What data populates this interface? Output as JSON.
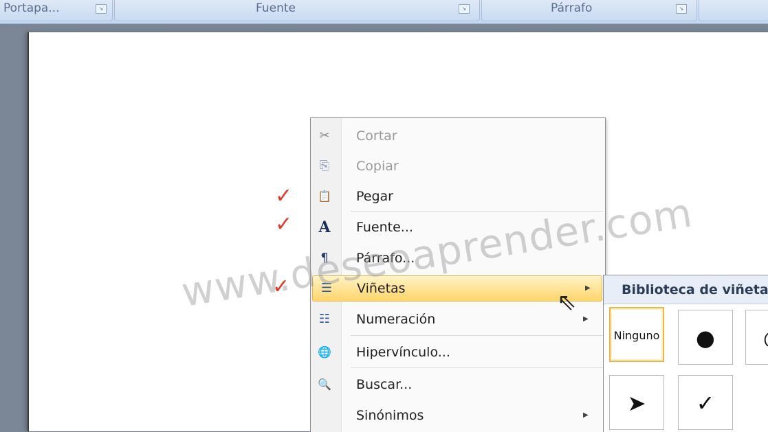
{
  "ribbon": {
    "groups": [
      {
        "label": "Portapa..."
      },
      {
        "label": "Fuente"
      },
      {
        "label": "Párrafo"
      }
    ]
  },
  "annotations": {
    "check": "✓"
  },
  "context_menu": {
    "items": [
      {
        "label": "Cortar",
        "icon": "scissors-icon",
        "glyph": "✂",
        "enabled": false
      },
      {
        "label": "Copiar",
        "icon": "copy-icon",
        "glyph": "⎘",
        "enabled": false
      },
      {
        "label": "Pegar",
        "icon": "paste-icon",
        "glyph": "📋",
        "enabled": true
      },
      {
        "label": "Fuente...",
        "icon": "font-icon",
        "glyph": "A",
        "enabled": true
      },
      {
        "label": "Párrafo...",
        "icon": "paragraph-icon",
        "glyph": "¶",
        "enabled": true
      },
      {
        "label": "Viñetas",
        "icon": "bullets-icon",
        "glyph": "☰",
        "enabled": true,
        "submenu": true,
        "highlighted": true
      },
      {
        "label": "Numeración",
        "icon": "numbering-icon",
        "glyph": "☷",
        "enabled": true,
        "submenu": true
      },
      {
        "label": "Hipervínculo...",
        "icon": "hyperlink-icon",
        "glyph": "🌐",
        "enabled": true
      },
      {
        "label": "Buscar...",
        "icon": "search-icon",
        "glyph": "🔍",
        "enabled": true
      },
      {
        "label": "Sinónimos",
        "icon": "",
        "glyph": "",
        "enabled": true,
        "submenu": true
      }
    ]
  },
  "bullet_submenu": {
    "title": "Biblioteca de viñetas",
    "cells": [
      {
        "label": "Ninguno",
        "selected": true
      },
      {
        "label": "●"
      },
      {
        "label": "○"
      },
      {
        "label": "➤"
      },
      {
        "label": "✓"
      }
    ]
  },
  "watermark": "www.deseoaprender.com",
  "colors": {
    "highlight": "#ffd56b",
    "annotation": "#e23a2a"
  }
}
